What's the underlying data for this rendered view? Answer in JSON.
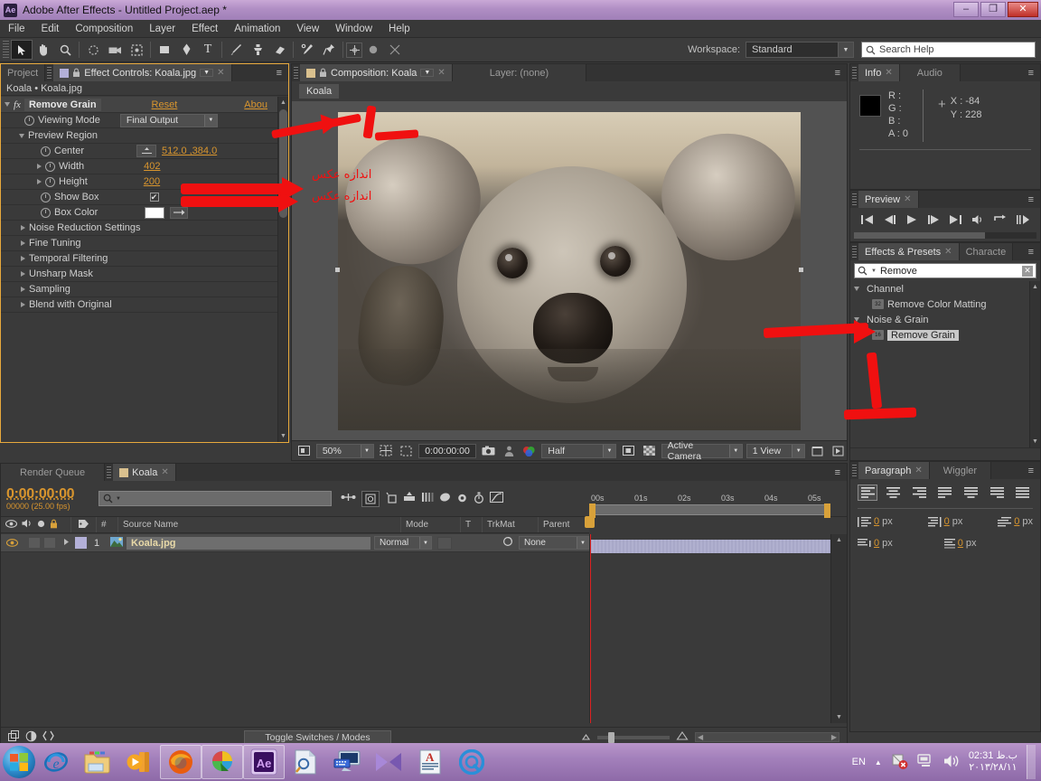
{
  "window": {
    "title": "Adobe After Effects - Untitled Project.aep *",
    "app_badge": "Ae",
    "minimize": "–",
    "maximize": "❐",
    "close": "✕"
  },
  "menubar": {
    "items": [
      "File",
      "Edit",
      "Composition",
      "Layer",
      "Effect",
      "Animation",
      "View",
      "Window",
      "Help"
    ]
  },
  "toolbar": {
    "workspace_label": "Workspace:",
    "workspace_value": "Standard",
    "search_placeholder": "Search Help",
    "tools": [
      "selection-tool",
      "hand-tool",
      "zoom-tool",
      "rotation-tool",
      "camera-tool",
      "pan-behind-tool",
      "shape-tool",
      "pen-tool",
      "type-tool",
      "brush-tool",
      "clone-stamp-tool",
      "eraser-tool",
      "roto-brush-tool",
      "puppet-pin-tool"
    ]
  },
  "effect_controls": {
    "tab_project": "Project",
    "tab_active": "Effect Controls: Koala.jpg",
    "breadcrumb": "Koala • Koala.jpg",
    "effect_name": "Remove Grain",
    "reset": "Reset",
    "about": "Abou",
    "properties": [
      {
        "label": "Viewing Mode",
        "type": "dropdown",
        "value": "Final Output"
      },
      {
        "label": "Preview Region",
        "type": "group"
      },
      {
        "label": "Center",
        "type": "point",
        "value": "512.0 ,384.0"
      },
      {
        "label": "Width",
        "type": "number",
        "value": "402"
      },
      {
        "label": "Height",
        "type": "number",
        "value": "200"
      },
      {
        "label": "Show Box",
        "type": "checkbox",
        "value": "✔"
      },
      {
        "label": "Box Color",
        "type": "color",
        "value": "#ffffff"
      }
    ],
    "groups": [
      "Noise Reduction Settings",
      "Fine Tuning",
      "Temporal Filtering",
      "Unsharp Mask",
      "Sampling",
      "Blend with Original"
    ]
  },
  "composition": {
    "tab_title": "Composition: Koala",
    "tab_layer": "Layer: (none)",
    "crumb": "Koala",
    "zoom": "50%",
    "timecode": "0:00:00:00",
    "resolution": "Half",
    "camera": "Active Camera",
    "views": "1 View"
  },
  "info": {
    "tab": "Info",
    "tab_audio": "Audio",
    "r": "R :",
    "g": "G :",
    "b": "B :",
    "a": "A : 0",
    "x": "X : -84",
    "y": "Y : 228"
  },
  "preview": {
    "tab": "Preview",
    "buttons": [
      "first-frame",
      "prev-frame",
      "play",
      "next-frame",
      "last-frame",
      "audio",
      "loop",
      "ram-preview"
    ]
  },
  "effects_presets": {
    "tab": "Effects & Presets",
    "tab_character": "Characte",
    "search_value": "Remove",
    "categories": [
      {
        "name": "Channel",
        "items": [
          {
            "label": "Remove Color Matting",
            "badge": "32",
            "selected": false
          }
        ]
      },
      {
        "name": "Noise & Grain",
        "items": [
          {
            "label": "Remove Grain",
            "badge": "16",
            "selected": true
          }
        ]
      }
    ]
  },
  "paragraph": {
    "tab": "Paragraph",
    "tab_wiggler": "Wiggler",
    "align_buttons": [
      "align-left",
      "align-center",
      "align-right",
      "justify-last-left",
      "justify-last-center",
      "justify-last-right",
      "justify-all"
    ],
    "fields": [
      {
        "name": "indent-left",
        "value": "0",
        "unit": "px"
      },
      {
        "name": "indent-right",
        "value": "0",
        "unit": "px"
      },
      {
        "name": "indent-first-line",
        "value": "0",
        "unit": "px"
      },
      {
        "name": "space-before",
        "value": "0",
        "unit": "px"
      },
      {
        "name": "space-after",
        "value": "0",
        "unit": "px"
      }
    ]
  },
  "timeline": {
    "tab_render": "Render Queue",
    "tab_comp": "Koala",
    "timecode": "0:00:00:00",
    "frames": "00000 (25.00 fps)",
    "search_placeholder": "",
    "columns": [
      "#",
      "Source Name",
      "Mode",
      "T",
      "TrkMat",
      "Parent"
    ],
    "layers": [
      {
        "index": "1",
        "source_name": "Koala.jpg",
        "mode": "Normal",
        "parent": "None"
      }
    ],
    "ruler_labels": [
      "00s",
      "01s",
      "02s",
      "03s",
      "04s",
      "05s"
    ],
    "toggle_switches": "Toggle Switches / Modes"
  },
  "annotations": {
    "text1": "اندازه عکس",
    "text2": "اندازه عکس"
  },
  "taskbar": {
    "language": "EN",
    "time": "02:31 ب.ظ",
    "date": "۲۰۱۳/۲۸/۱۱",
    "items": [
      "start-orb",
      "internet-explorer",
      "file-explorer",
      "media-player",
      "firefox",
      "internet-download-manager",
      "after-effects",
      "search-document",
      "remote-desktop",
      "media-converter",
      "wordpad",
      "quicktime"
    ]
  }
}
